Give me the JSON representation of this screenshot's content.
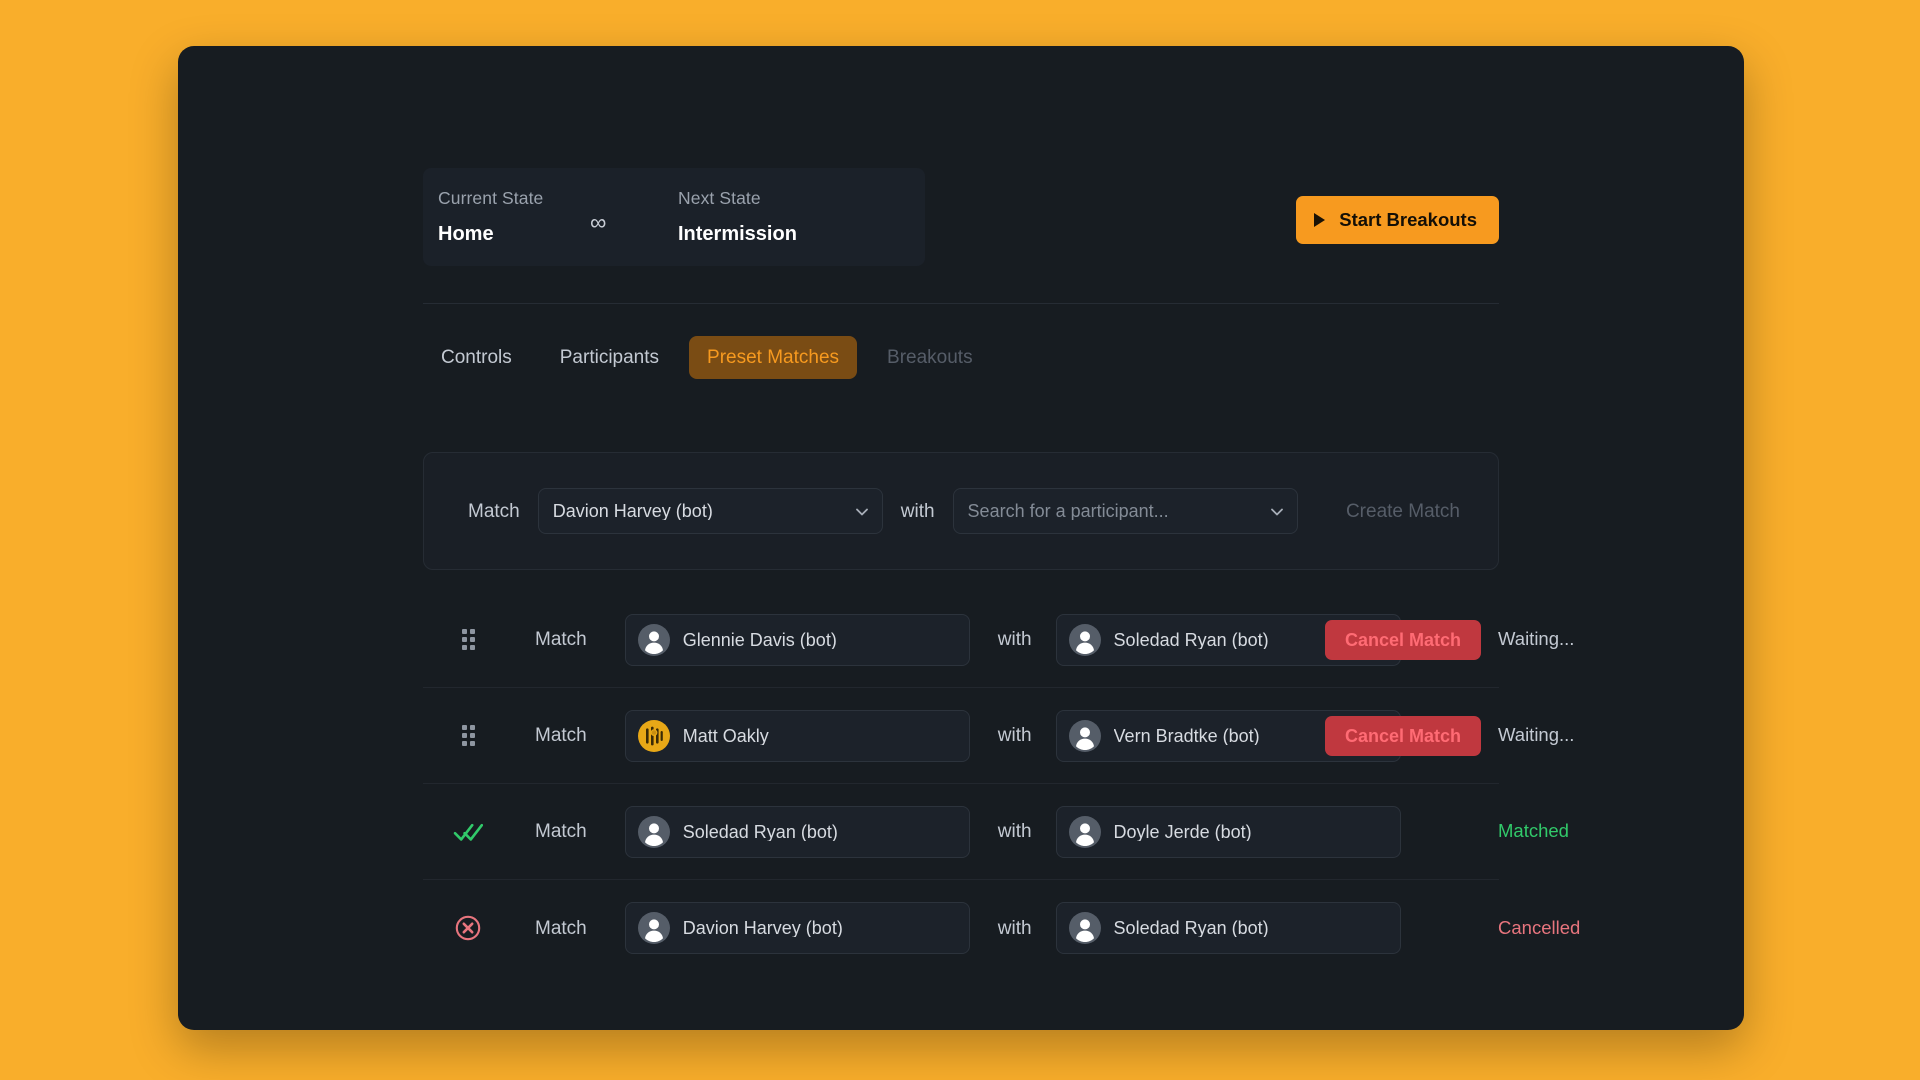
{
  "theme": {
    "page_background": "#F9AE2B",
    "card_background": "#171c21",
    "accent": "#F79A1F",
    "success": "#31c96a",
    "danger": "#e8757e",
    "cancel_button_bg": "#c0383f"
  },
  "state_bar": {
    "current_label": "Current State",
    "current_value": "Home",
    "transition_symbol": "∞",
    "next_label": "Next State",
    "next_value": "Intermission"
  },
  "header": {
    "start_button_label": "Start Breakouts",
    "start_button_icon": "play-icon"
  },
  "tabs": [
    {
      "label": "Controls",
      "state": "normal"
    },
    {
      "label": "Participants",
      "state": "normal"
    },
    {
      "label": "Preset Matches",
      "state": "active"
    },
    {
      "label": "Breakouts",
      "state": "disabled"
    }
  ],
  "create_panel": {
    "match_label": "Match",
    "with_label": "with",
    "first_select_value": "Davion Harvey (bot)",
    "second_select_placeholder": "Search for a participant...",
    "second_select_value": "",
    "create_button_label": "Create Match",
    "chevron_icon": "chevron-down-icon"
  },
  "match_rows": [
    {
      "handle_icon": "drag-handle-icon",
      "match_label": "Match",
      "participant_a": "Glennie Davis (bot)",
      "participant_a_avatar": "person-avatar-icon",
      "with_label": "with",
      "participant_b": "Soledad Ryan (bot)",
      "participant_b_avatar": "person-avatar-icon",
      "status": "Waiting...",
      "status_kind": "waiting",
      "action_label": "Cancel Match",
      "has_action": true
    },
    {
      "handle_icon": "drag-handle-icon",
      "match_label": "Match",
      "participant_a": "Matt Oakly",
      "participant_a_avatar": "bee-avatar-icon",
      "with_label": "with",
      "participant_b": "Vern Bradtke (bot)",
      "participant_b_avatar": "person-avatar-icon",
      "status": "Waiting...",
      "status_kind": "waiting",
      "action_label": "Cancel Match",
      "has_action": true
    },
    {
      "handle_icon": "double-check-icon",
      "match_label": "Match",
      "participant_a": "Soledad Ryan (bot)",
      "participant_a_avatar": "person-avatar-icon",
      "with_label": "with",
      "participant_b": "Doyle Jerde (bot)",
      "participant_b_avatar": "person-avatar-icon",
      "status": "Matched",
      "status_kind": "matched",
      "action_label": "",
      "has_action": false
    },
    {
      "handle_icon": "cancel-circle-icon",
      "match_label": "Match",
      "participant_a": "Davion Harvey (bot)",
      "participant_a_avatar": "person-avatar-icon",
      "with_label": "with",
      "participant_b": "Soledad Ryan (bot)",
      "participant_b_avatar": "person-avatar-icon",
      "status": "Cancelled",
      "status_kind": "cancelled",
      "action_label": "",
      "has_action": false
    }
  ]
}
